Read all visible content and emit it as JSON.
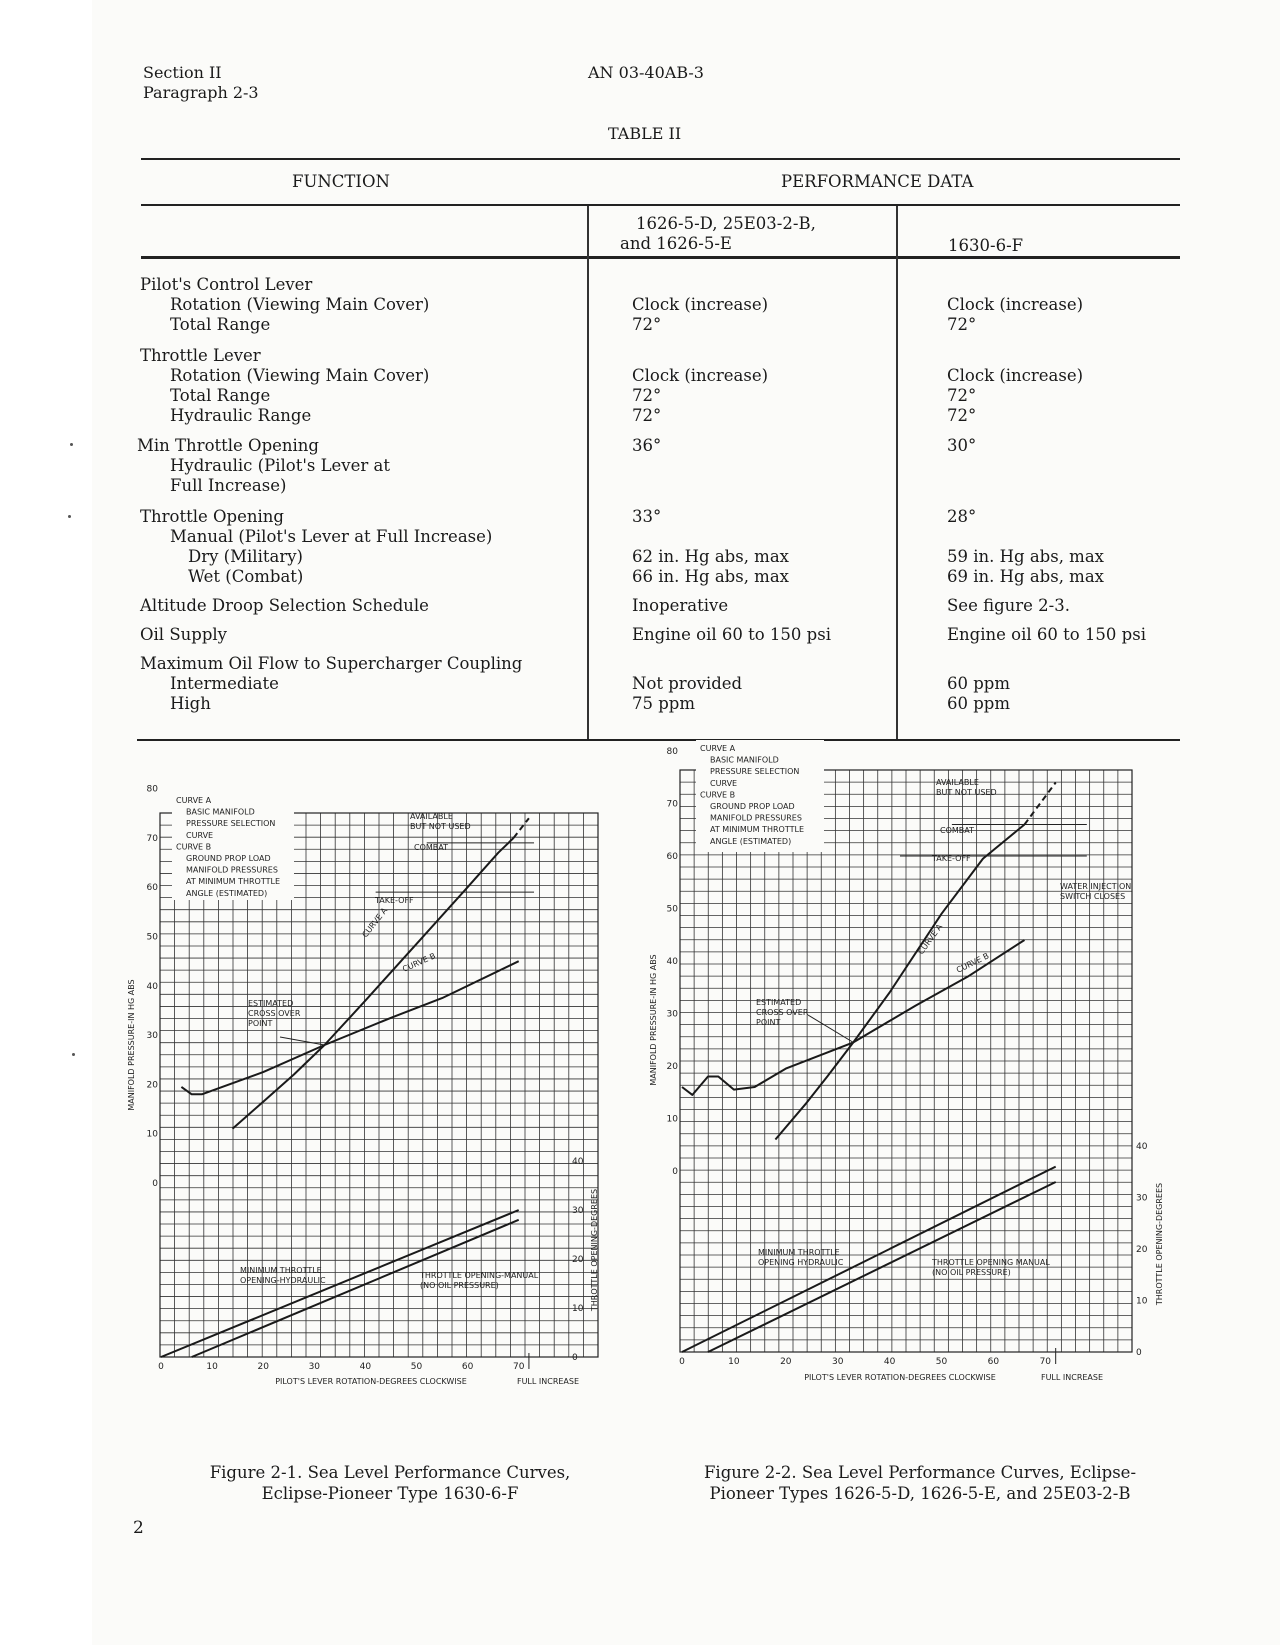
{
  "header": {
    "section": "Section II",
    "paragraph": "Paragraph 2-3",
    "doc_number": "AN 03-40AB-3",
    "table_title": "TABLE II"
  },
  "table": {
    "col_function": "FUNCTION",
    "col_performance": "PERFORMANCE DATA",
    "sub_col_1_line1": "1626-5-D, 25E03-2-B,",
    "sub_col_1_line2": "and 1626-5-E",
    "sub_col_2": "1630-6-F",
    "rows": [
      {
        "label": "Pilot's Control Lever",
        "indent": 0,
        "v1": "",
        "v2": ""
      },
      {
        "label": "Rotation (Viewing Main Cover)",
        "indent": 1,
        "v1": "Clock (increase)",
        "v2": "Clock (increase)"
      },
      {
        "label": "Total Range",
        "indent": 1,
        "v1": "72°",
        "v2": "72°"
      },
      {
        "label": "Throttle Lever",
        "indent": 0,
        "v1": "",
        "v2": ""
      },
      {
        "label": "Rotation (Viewing Main Cover)",
        "indent": 1,
        "v1": "Clock (increase)",
        "v2": "Clock (increase)"
      },
      {
        "label": "Total Range",
        "indent": 1,
        "v1": "72°",
        "v2": "72°"
      },
      {
        "label": "Hydraulic Range",
        "indent": 1,
        "v1": "72°",
        "v2": "72°"
      },
      {
        "label": "Min Throttle Opening",
        "indent": 0,
        "v1": "36°",
        "v2": "30°"
      },
      {
        "label": "Hydraulic (Pilot's Lever at",
        "indent": 1,
        "v1": "",
        "v2": ""
      },
      {
        "label": "Full Increase)",
        "indent": 1,
        "v1": "",
        "v2": ""
      },
      {
        "label": "Throttle Opening",
        "indent": 0,
        "v1": "33°",
        "v2": "28°"
      },
      {
        "label": "Manual (Pilot's Lever at Full Increase)",
        "indent": 1,
        "v1": "",
        "v2": ""
      },
      {
        "label": "Dry (Military)",
        "indent": 2,
        "v1": "62 in. Hg abs, max",
        "v2": "59 in. Hg abs, max"
      },
      {
        "label": "Wet (Combat)",
        "indent": 2,
        "v1": "66 in. Hg abs, max",
        "v2": "69 in. Hg abs, max"
      },
      {
        "label": "Altitude Droop Selection Schedule",
        "indent": 0,
        "v1": "Inoperative",
        "v2": "See figure 2-3."
      },
      {
        "label": "Oil Supply",
        "indent": 0,
        "v1": "Engine oil 60 to 150 psi",
        "v2": "Engine oil 60 to 150 psi"
      },
      {
        "label": "Maximum Oil Flow to Supercharger Coupling",
        "indent": 0,
        "v1": "",
        "v2": ""
      },
      {
        "label": "Intermediate",
        "indent": 1,
        "v1": "Not provided",
        "v2": "60 ppm"
      },
      {
        "label": "High",
        "indent": 1,
        "v1": "75 ppm",
        "v2": "60 ppm"
      }
    ]
  },
  "figures": {
    "fig1_caption_line1": "Figure 2-1. Sea Level Performance Curves,",
    "fig1_caption_line2": "Eclipse-Pioneer Type 1630-6-F",
    "fig2_caption_line1": "Figure 2-2. Sea Level Performance Curves, Eclipse-",
    "fig2_caption_line2": "Pioneer Types 1626-5-D, 1626-5-E, and 25E03-2-B"
  },
  "page_number": "2",
  "chart_data": [
    {
      "type": "line",
      "title": "Figure 2-1. Sea Level Performance Curves, Eclipse-Pioneer Type 1630-6-F",
      "xlabel": "PILOT'S LEVER ROTATION-DEGREES CLOCKWISE",
      "xlabel_end": "FULL INCREASE",
      "ylabel": "MANIFOLD PRESSURE-IN HG ABS",
      "ylabel_right": "THROTTLE OPENING-DEGREES",
      "xlim": [
        0,
        80
      ],
      "ylim": [
        0,
        80
      ],
      "ylim_right": [
        0,
        40
      ],
      "x_ticks": [
        0,
        10,
        20,
        30,
        40,
        50,
        60,
        70
      ],
      "y_ticks": [
        0,
        10,
        20,
        30,
        40,
        50,
        60,
        70,
        80
      ],
      "y_ticks_right": [
        0,
        10,
        20,
        30,
        40
      ],
      "grid": true,
      "legend_text": [
        "CURVE A",
        "BASIC MANIFOLD",
        "PRESSURE SELECTION",
        "CURVE",
        "CURVE B",
        "GROUND PROP LOAD",
        "MANIFOLD PRESSURES",
        "AT MINIMUM THROTTLE",
        "ANGLE (ESTIMATED)"
      ],
      "legend_position": "top-left",
      "series": [
        {
          "name": "CURVE A",
          "axis": "left",
          "x": [
            14,
            20,
            26,
            32,
            40,
            50,
            60,
            66,
            69
          ],
          "y": [
            11,
            16.5,
            22,
            28,
            37,
            48.5,
            60,
            67,
            70
          ]
        },
        {
          "name": "CURVE A (available but not used)",
          "axis": "left",
          "style": "dashed",
          "x": [
            69,
            72
          ],
          "y": [
            70,
            74
          ]
        },
        {
          "name": "CURVE B",
          "axis": "left",
          "x": [
            4,
            6,
            8,
            20,
            32,
            45,
            55,
            70
          ],
          "y": [
            19.5,
            18,
            18,
            22.5,
            28,
            33.5,
            37.5,
            45
          ]
        },
        {
          "name": "MINIMUM THROTTLE OPENING-HYDRAULIC",
          "axis": "right",
          "x": [
            0,
            70
          ],
          "y": [
            0,
            30
          ]
        },
        {
          "name": "THROTTLE OPENING-MANUAL (NO OIL PRESSURE)",
          "axis": "right",
          "x": [
            6,
            70
          ],
          "y": [
            0,
            28
          ]
        }
      ],
      "reference_lines": [
        {
          "label": "TAKE-OFF",
          "y": 59
        },
        {
          "label": "COMBAT",
          "y": 69
        }
      ],
      "annotations": [
        "AVAILABLE BUT NOT USED",
        "COMBAT",
        "TAKE-OFF",
        "ESTIMATED CROSS OVER POINT",
        "CURVE A",
        "CURVE B",
        "MINIMUM THROTTLE OPENING-HYDRAULIC",
        "THROTTLE OPENING-MANUAL (NO OIL PRESSURE)"
      ],
      "crossover": {
        "x": 32,
        "y": 28
      }
    },
    {
      "type": "line",
      "title": "Figure 2-2. Sea Level Performance Curves, Eclipse-Pioneer Types 1626-5-D, 1626-5-E, and 25E03-2-B",
      "xlabel": "PILOT'S LEVER ROTATION-DEGREES CLOCKWISE",
      "xlabel_end": "FULL INCREASE",
      "ylabel": "MANIFOLD PRESSURE-IN HG ABS",
      "ylabel_right": "THROTTLE OPENING-DEGREES",
      "xlim": [
        0,
        80
      ],
      "ylim": [
        0,
        80
      ],
      "ylim_right": [
        0,
        40
      ],
      "x_ticks": [
        0,
        10,
        20,
        30,
        40,
        50,
        60,
        70
      ],
      "y_ticks": [
        0,
        10,
        20,
        30,
        40,
        50,
        60,
        70,
        80
      ],
      "y_ticks_right": [
        0,
        10,
        20,
        30,
        40
      ],
      "grid": true,
      "legend_text": [
        "CURVE A",
        "BASIC MANIFOLD",
        "PRESSURE SELECTION",
        "CURVE",
        "CURVE B",
        "GROUND PROP LOAD",
        "MANIFOLD PRESSURES",
        "AT MINIMUM THROTTLE",
        "ANGLE (ESTIMATED)"
      ],
      "legend_position": "top-left",
      "series": [
        {
          "name": "CURVE A",
          "axis": "left",
          "x": [
            18,
            24,
            28,
            33,
            40,
            50,
            58,
            66
          ],
          "y": [
            6,
            13,
            18,
            24.5,
            34,
            49,
            59.5,
            66
          ]
        },
        {
          "name": "CURVE A (available but not used)",
          "axis": "left",
          "style": "dashed",
          "x": [
            66,
            72
          ],
          "y": [
            66,
            74
          ]
        },
        {
          "name": "CURVE B",
          "axis": "left",
          "x": [
            0,
            2,
            5,
            7,
            10,
            14,
            20,
            33,
            45,
            55,
            66
          ],
          "y": [
            16,
            14.5,
            18,
            18,
            15.5,
            16,
            19.5,
            24.5,
            31.5,
            37,
            44
          ]
        },
        {
          "name": "MINIMUM THROTTLE OPENING HYDRAULIC",
          "axis": "right",
          "x": [
            0,
            72
          ],
          "y": [
            0,
            36
          ]
        },
        {
          "name": "THROTTLE OPENING MANUAL (NO OIL PRESSURE)",
          "axis": "right",
          "x": [
            5,
            72
          ],
          "y": [
            0,
            33
          ]
        }
      ],
      "reference_lines": [
        {
          "label": "TAKE-OFF",
          "y": 60
        },
        {
          "label": "COMBAT",
          "y": 66
        }
      ],
      "annotations": [
        "AVAILABLE BUT NOT USED",
        "COMBAT",
        "TAKE-OFF",
        "WATER INJECTION SWITCH CLOSES",
        "ESTIMATED CROSS OVER POINT",
        "CURVE A",
        "CURVE B",
        "MINIMUM THROTTLE OPENING HYDRAULIC",
        "THROTTLE OPENING MANUAL (NO OIL PRESSURE)"
      ],
      "crossover": {
        "x": 33,
        "y": 24.5
      }
    }
  ]
}
